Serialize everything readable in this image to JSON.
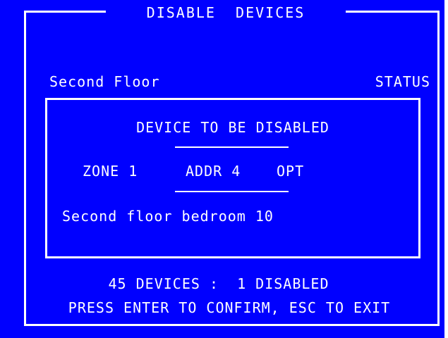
{
  "window": {
    "title": "DISABLE  DEVICES"
  },
  "header": {
    "location": "Second Floor",
    "status_label": "STATUS"
  },
  "device_panel": {
    "heading": "DEVICE TO BE DISABLED",
    "zone": "ZONE 1",
    "address": "ADDR 4",
    "type": "OPT",
    "description": "Second floor bedroom 10"
  },
  "footer": {
    "summary": "45 DEVICES :  1 DISABLED",
    "prompt": "PRESS ENTER TO CONFIRM, ESC TO EXIT"
  },
  "colors": {
    "background": "#0000ff",
    "foreground": "#ffffff"
  }
}
